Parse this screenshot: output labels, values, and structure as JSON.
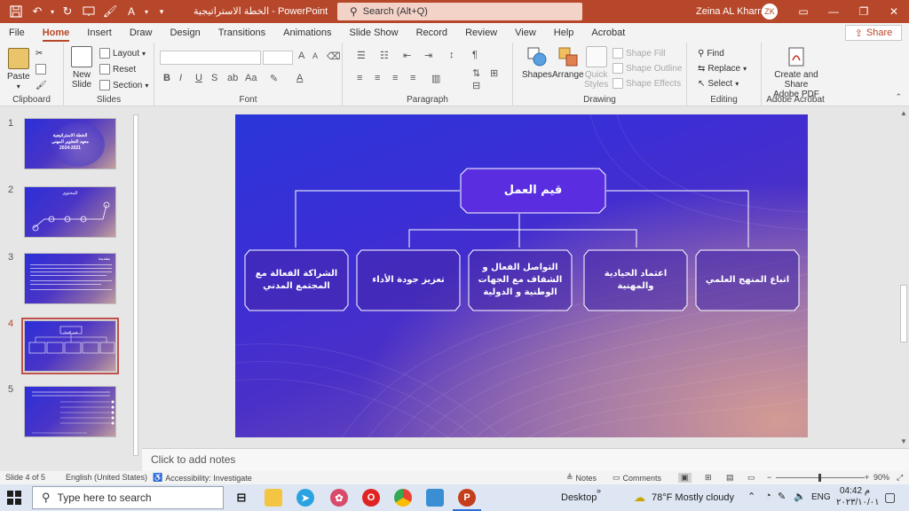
{
  "titlebar": {
    "doc_title": "الخطة الاستراتيجية  -  PowerPoint",
    "search_placeholder": "Search (Alt+Q)",
    "user_name": "Zeina AL Kharrat",
    "avatar_initials": "ZK",
    "accent": "#b7472a"
  },
  "tabs": [
    "File",
    "Home",
    "Insert",
    "Draw",
    "Design",
    "Transitions",
    "Animations",
    "Slide Show",
    "Record",
    "Review",
    "View",
    "Help",
    "Acrobat"
  ],
  "active_tab": "Home",
  "share_label": "Share",
  "ribbon": {
    "clipboard": {
      "label": "Clipboard",
      "paste": "Paste"
    },
    "slides": {
      "label": "Slides",
      "new_slide_1": "New",
      "new_slide_2": "Slide",
      "layout": "Layout",
      "reset": "Reset",
      "section": "Section"
    },
    "font": {
      "label": "Font",
      "bold": "B",
      "italic": "I",
      "underline": "U",
      "strike": "S",
      "abc": "ab",
      "aa": "Aa",
      "grow": "A",
      "shrink": "A"
    },
    "paragraph": {
      "label": "Paragraph"
    },
    "drawing": {
      "label": "Drawing",
      "shapes": "Shapes",
      "arrange": "Arrange",
      "quick_styles_1": "Quick",
      "quick_styles_2": "Styles",
      "shape_fill": "Shape Fill",
      "shape_outline": "Shape Outline",
      "shape_effects": "Shape Effects"
    },
    "editing": {
      "label": "Editing",
      "find": "Find",
      "replace": "Replace",
      "select": "Select"
    },
    "acrobat": {
      "label": "Adobe Acrobat",
      "create_1": "Create and Share",
      "create_2": "Adobe PDF"
    }
  },
  "thumbnails": [
    {
      "num": "1",
      "title_lines": [
        "الخطة الاستراتيجية",
        "معهد التطوير المهني",
        "2024-2021"
      ]
    },
    {
      "num": "2",
      "title_lines": [
        "المحتوى"
      ]
    },
    {
      "num": "3",
      "title_lines": [
        "مقدمة"
      ]
    },
    {
      "num": "4",
      "title_lines": [
        "قيم العمل"
      ]
    },
    {
      "num": "5",
      "title_lines": [
        ""
      ]
    }
  ],
  "active_slide": "4",
  "slide": {
    "root": "قيم العمل",
    "children": [
      "اتباع المنهج العلمي",
      "اعتماد الحيادية والمهنية",
      "التواصل الفعال و الشفاف مع الجهات الوطنية و الدولية",
      "تعزيز جودة الأداء",
      "الشراكة الفعالة مع المجتمع المدني"
    ]
  },
  "notes_placeholder": "Click to add notes",
  "status": {
    "slide_of": "Slide 4 of 5",
    "language": "English (United States)",
    "accessibility": "Accessibility: Investigate",
    "notes": "Notes",
    "comments": "Comments",
    "zoom": "90%"
  },
  "taskbar": {
    "search_placeholder": "Type here to search",
    "desktop": "Desktop",
    "weather": "78°F  Mostly cloudy",
    "lang": "ENG",
    "time": "04:42 م",
    "date": "٢٠٢٣/١٠/٠١"
  }
}
